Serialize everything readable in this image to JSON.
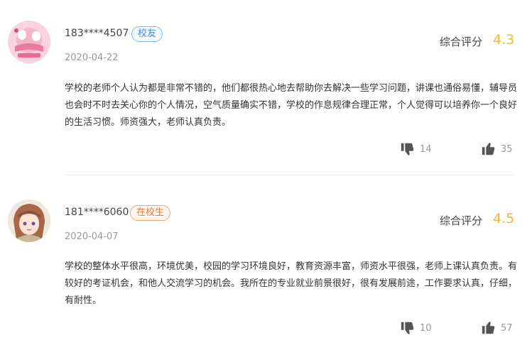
{
  "reviews": [
    {
      "username": "183****4507",
      "badge": "校友",
      "date": "2020-04-22",
      "score_label": "综合评分",
      "score": "4.3",
      "content": "学校的老师个人认为都是非常不错的，他们都很热心地去帮助你去解决一些学习问题，讲课也通俗易懂，辅导员也会时不时去关心你的个人情况，空气质量确实不错，学校的作息规律合理正常，个人觉得可以培养你一个良好的生活习惯。师资强大，老师认真负责。",
      "dislikes": "14",
      "likes": "35"
    },
    {
      "username": "181****6060",
      "badge": "在校生",
      "date": "2020-04-07",
      "score_label": "综合评分",
      "score": "4.5",
      "content": "学校的整体水平很高，环境优美，校园的学习环境良好，教育资源丰富，师资水平很强，老师上课认真负责。有较好的考证机会，和他人交流学习的机会。我所在的专业就业前景很好，很有发展前途，工作要求认真，仔细，有耐性。",
      "dislikes": "10",
      "likes": "57"
    }
  ],
  "colors": {
    "score": "#f5b731",
    "badge_alumni": "#3b8fd9",
    "badge_student": "#e8793a"
  },
  "icons": {
    "dislike": "thumbs-down-icon",
    "like": "thumbs-up-icon"
  }
}
